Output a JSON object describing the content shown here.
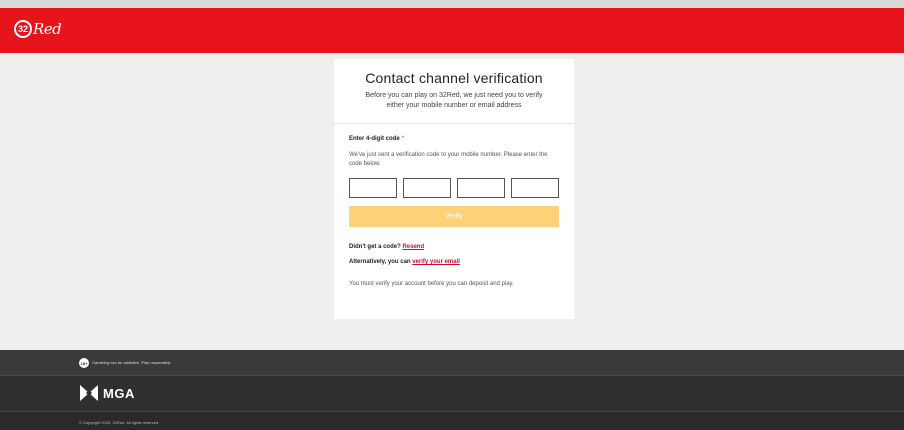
{
  "header": {
    "logo_number": "32",
    "logo_word": "Red"
  },
  "card": {
    "title": "Contact channel verification",
    "subtitle": "Before you can play on 32Red, we just need you to verify either your mobile number or email address",
    "field_label": "Enter 4-digit code",
    "required_mark": "*",
    "help_text": "We've just sent a verification code to your mobile number. Please enter the code below.",
    "code_inputs": [
      "",
      "",
      "",
      ""
    ],
    "verify_label": "Verify",
    "resend_prompt": "Didn't get a code?",
    "resend_link": "Resend",
    "alt_prompt": "Alternatively, you can",
    "alt_link": "verify your email",
    "notice": "You must verify your account before you can deposit and play."
  },
  "footer": {
    "age_badge": "18+",
    "responsible_text": "Gambling can be addictive. Play responsibly",
    "mga_text": "MGA",
    "copyright": "© Copyright 2025, 32Red. All rights reserved."
  },
  "colors": {
    "brand_red": "#e8141c",
    "verify_disabled": "#ffd27a",
    "footer_dark": "#3a3a3a"
  }
}
